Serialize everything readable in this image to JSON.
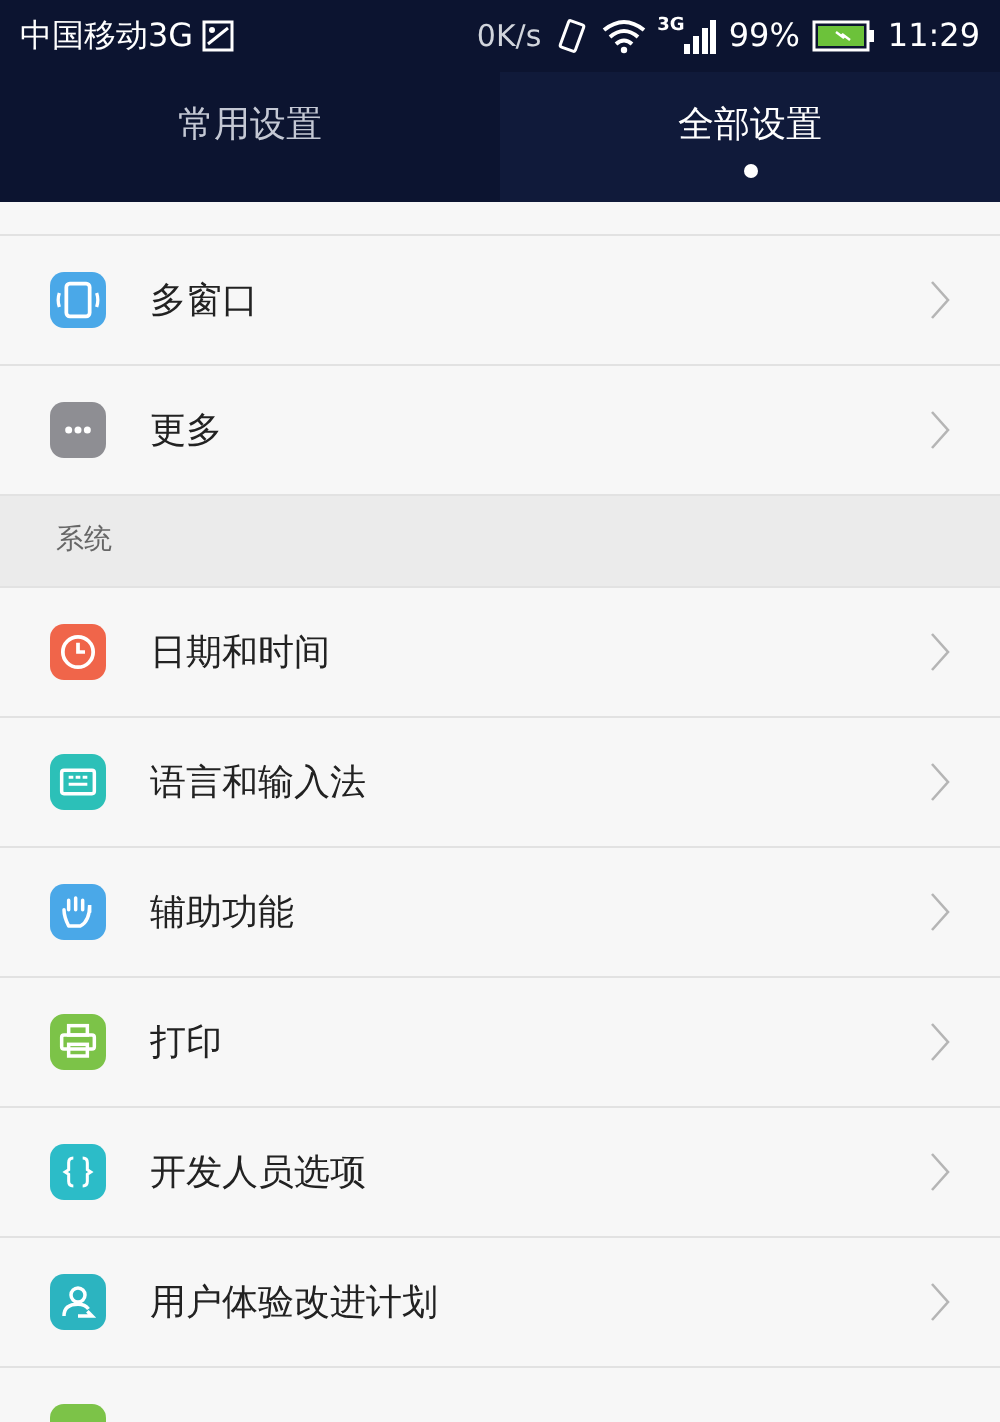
{
  "status_bar": {
    "carrier": "中国移动3G",
    "speed": "0K/s",
    "network": "3G",
    "battery": "99%",
    "time": "11:29"
  },
  "tabs": [
    {
      "label": "常用设置",
      "selected": false
    },
    {
      "label": "全部设置",
      "selected": true
    }
  ],
  "sections": [
    {
      "items": [
        {
          "label": "多窗口",
          "color": "#4aa8e8"
        },
        {
          "label": "更多",
          "color": "#8e8e93"
        }
      ]
    },
    {
      "title": "系统",
      "items": [
        {
          "label": "日期和时间",
          "color": "#f0654a"
        },
        {
          "label": "语言和输入法",
          "color": "#2cc0b8"
        },
        {
          "label": "辅助功能",
          "color": "#4aa8e8"
        },
        {
          "label": "打印",
          "color": "#7cc348"
        },
        {
          "label": "开发人员选项",
          "color": "#2cbcc8"
        },
        {
          "label": "用户体验改进计划",
          "color": "#2cb4c0"
        },
        {
          "color": "#7cc348"
        }
      ]
    }
  ]
}
